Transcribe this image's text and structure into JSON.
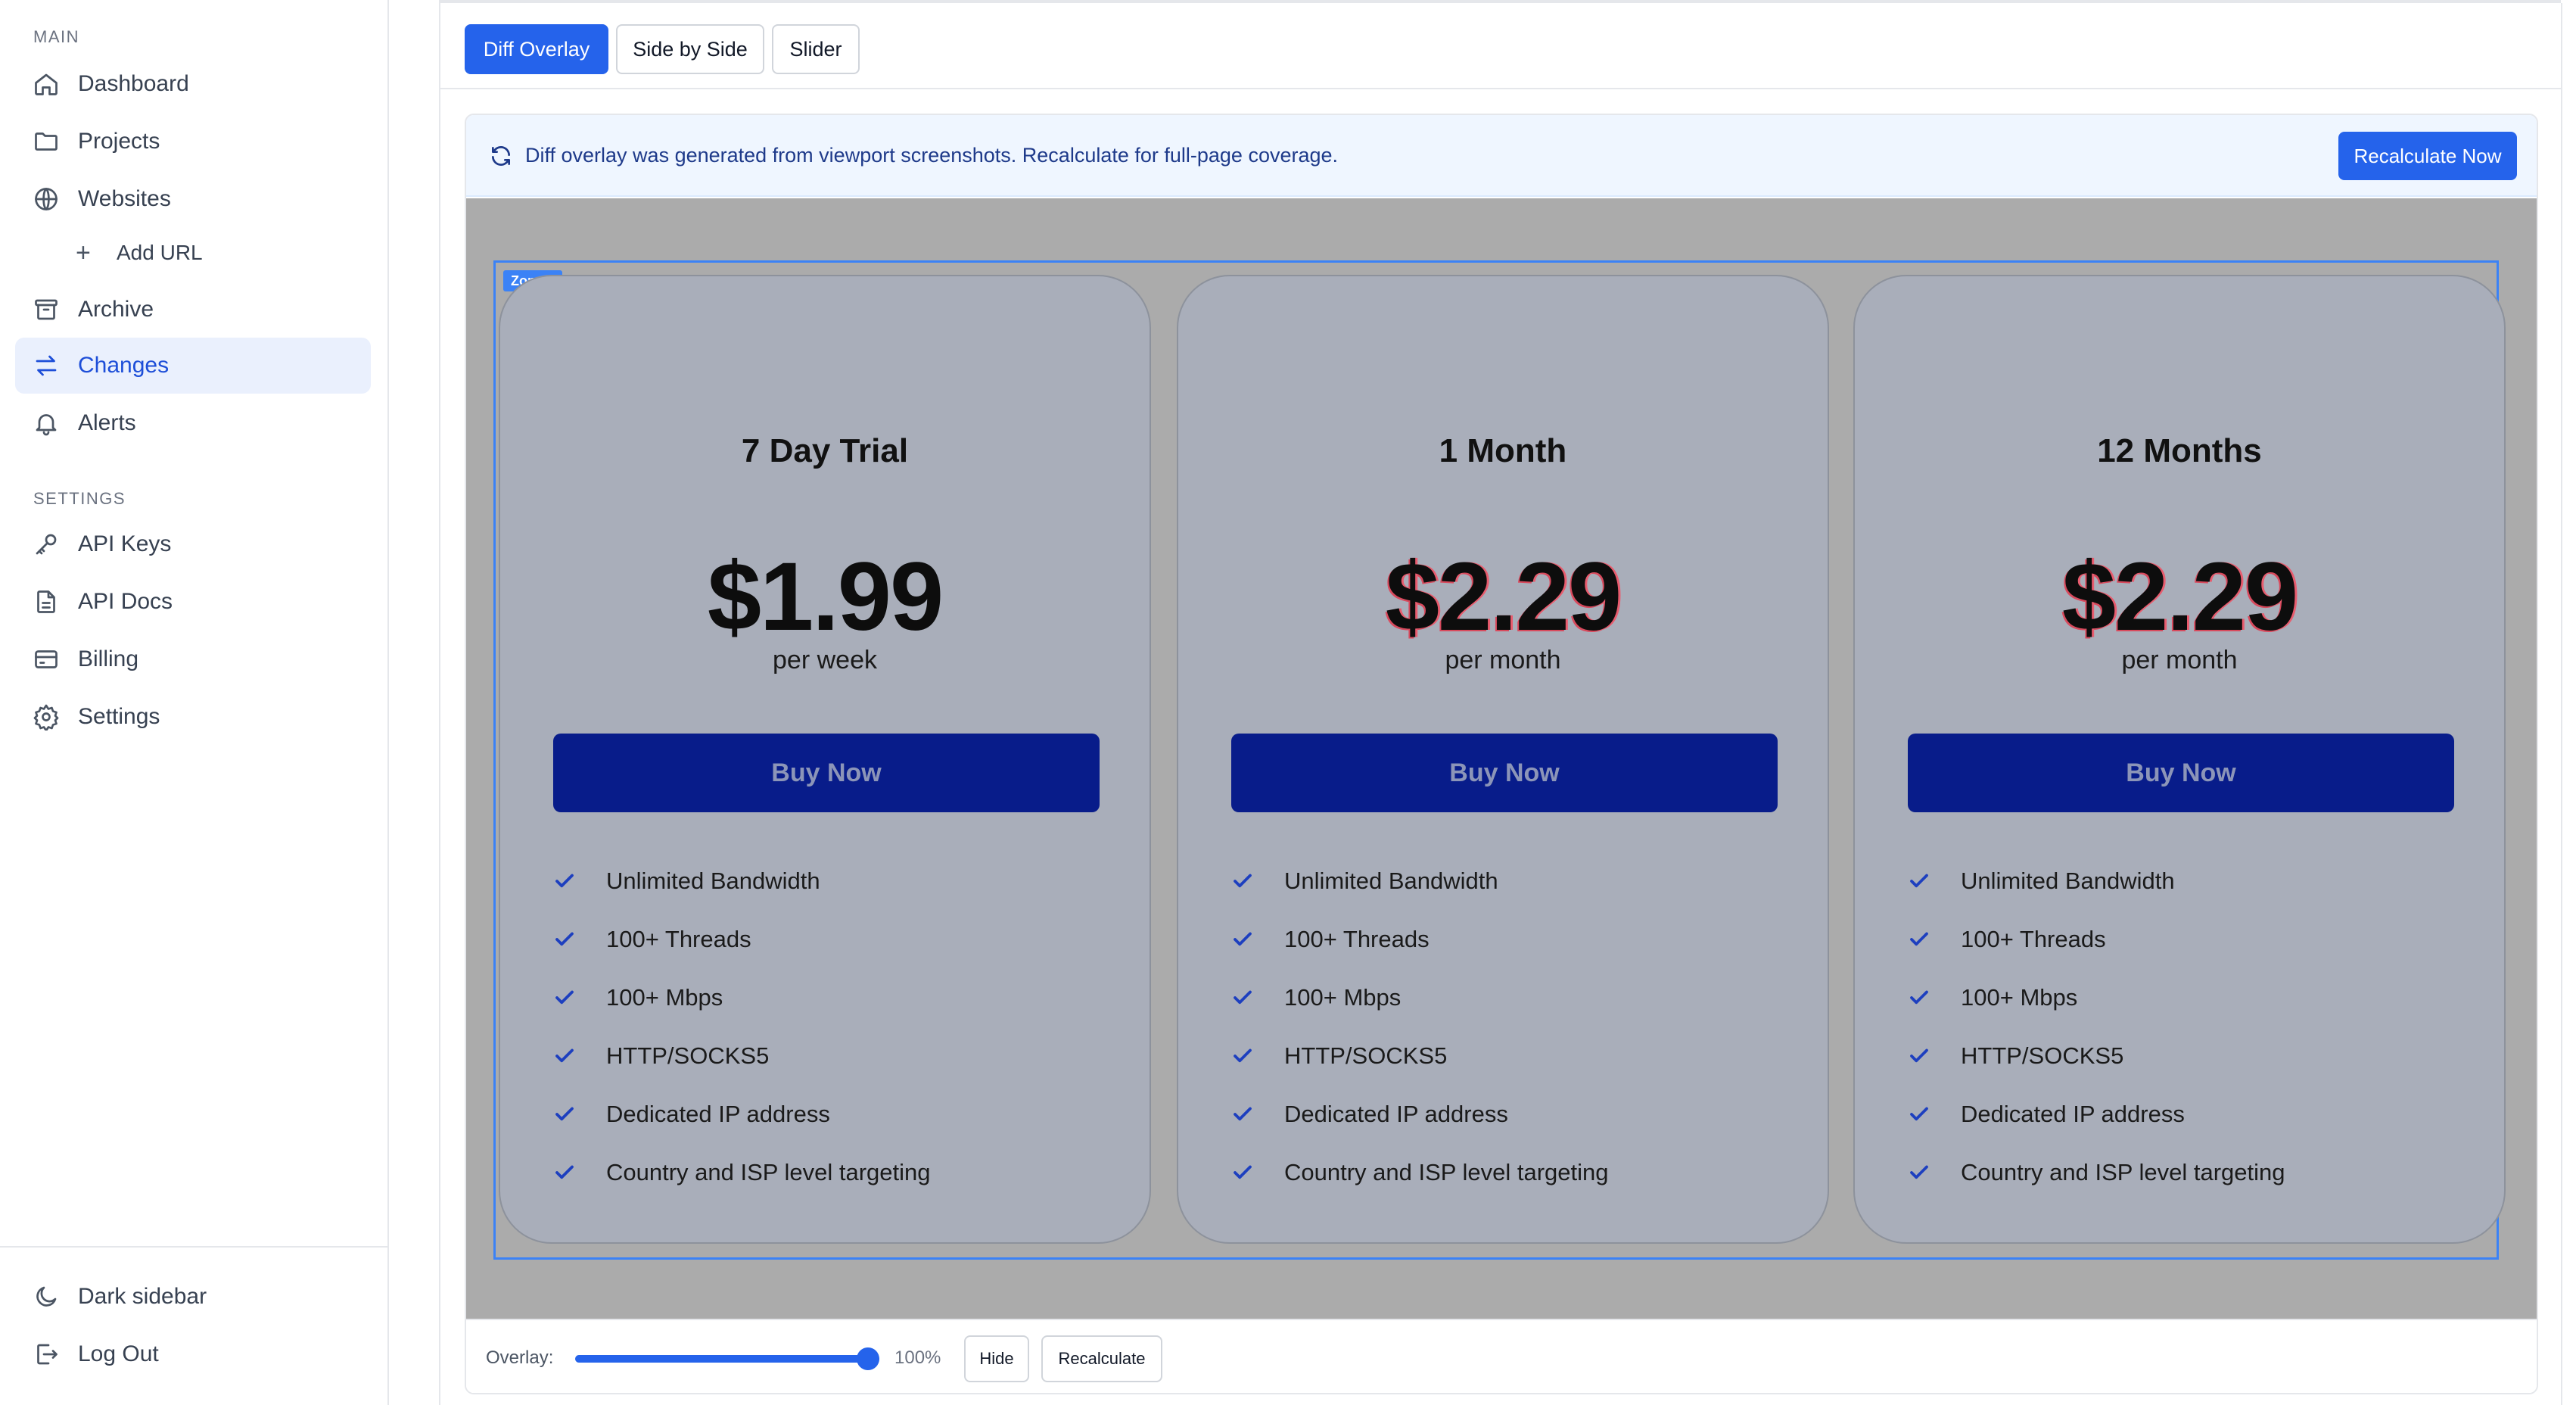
{
  "sidebar": {
    "section_main": "MAIN",
    "section_settings": "SETTINGS",
    "items": [
      {
        "label": "Dashboard",
        "icon": "home-icon"
      },
      {
        "label": "Projects",
        "icon": "folder-icon"
      },
      {
        "label": "Websites",
        "icon": "globe-icon"
      },
      {
        "label": "Add URL",
        "icon": "plus-icon"
      },
      {
        "label": "Archive",
        "icon": "archive-icon"
      },
      {
        "label": "Changes",
        "icon": "arrows-swap-icon",
        "active": true
      },
      {
        "label": "Alerts",
        "icon": "bell-icon"
      }
    ],
    "settings_items": [
      {
        "label": "API Keys",
        "icon": "key-icon"
      },
      {
        "label": "API Docs",
        "icon": "document-icon"
      },
      {
        "label": "Billing",
        "icon": "credit-card-icon"
      },
      {
        "label": "Settings",
        "icon": "gear-icon"
      }
    ],
    "footer_items": [
      {
        "label": "Dark sidebar",
        "icon": "moon-icon"
      },
      {
        "label": "Log Out",
        "icon": "logout-icon"
      }
    ]
  },
  "view_tabs": [
    {
      "label": "Diff Overlay",
      "active": true
    },
    {
      "label": "Side by Side",
      "active": false
    },
    {
      "label": "Slider",
      "active": false
    }
  ],
  "banner": {
    "message": "Diff overlay was generated from viewport screenshots. Recalculate for full-page coverage.",
    "button": "Recalculate Now"
  },
  "zone_label": "Zone 1",
  "cards": [
    {
      "title": "7 Day Trial",
      "price": "$1.99",
      "period": "per week",
      "button": "Buy Now",
      "changed": false,
      "features": [
        "Unlimited Bandwidth",
        "100+ Threads",
        "100+ Mbps",
        "HTTP/SOCKS5",
        "Dedicated IP address",
        "Country and ISP level targeting"
      ]
    },
    {
      "title": "1 Month",
      "price": "$2.29",
      "period": "per month",
      "button": "Buy Now",
      "changed": true,
      "features": [
        "Unlimited Bandwidth",
        "100+ Threads",
        "100+ Mbps",
        "HTTP/SOCKS5",
        "Dedicated IP address",
        "Country and ISP level targeting"
      ]
    },
    {
      "title": "12 Months",
      "price": "$2.29",
      "period": "per month",
      "button": "Buy Now",
      "changed": true,
      "features": [
        "Unlimited Bandwidth",
        "100+ Threads",
        "100+ Mbps",
        "HTTP/SOCKS5",
        "Dedicated IP address",
        "Country and ISP level targeting"
      ]
    }
  ],
  "controls": {
    "overlay_label": "Overlay:",
    "overlay_value": 100,
    "overlay_text": "100%",
    "hide_button": "Hide",
    "recalculate_button": "Recalculate"
  },
  "colors": {
    "accent": "#2563eb",
    "diff_highlight": "#e85c6e",
    "buy_button": "#081c8a"
  }
}
